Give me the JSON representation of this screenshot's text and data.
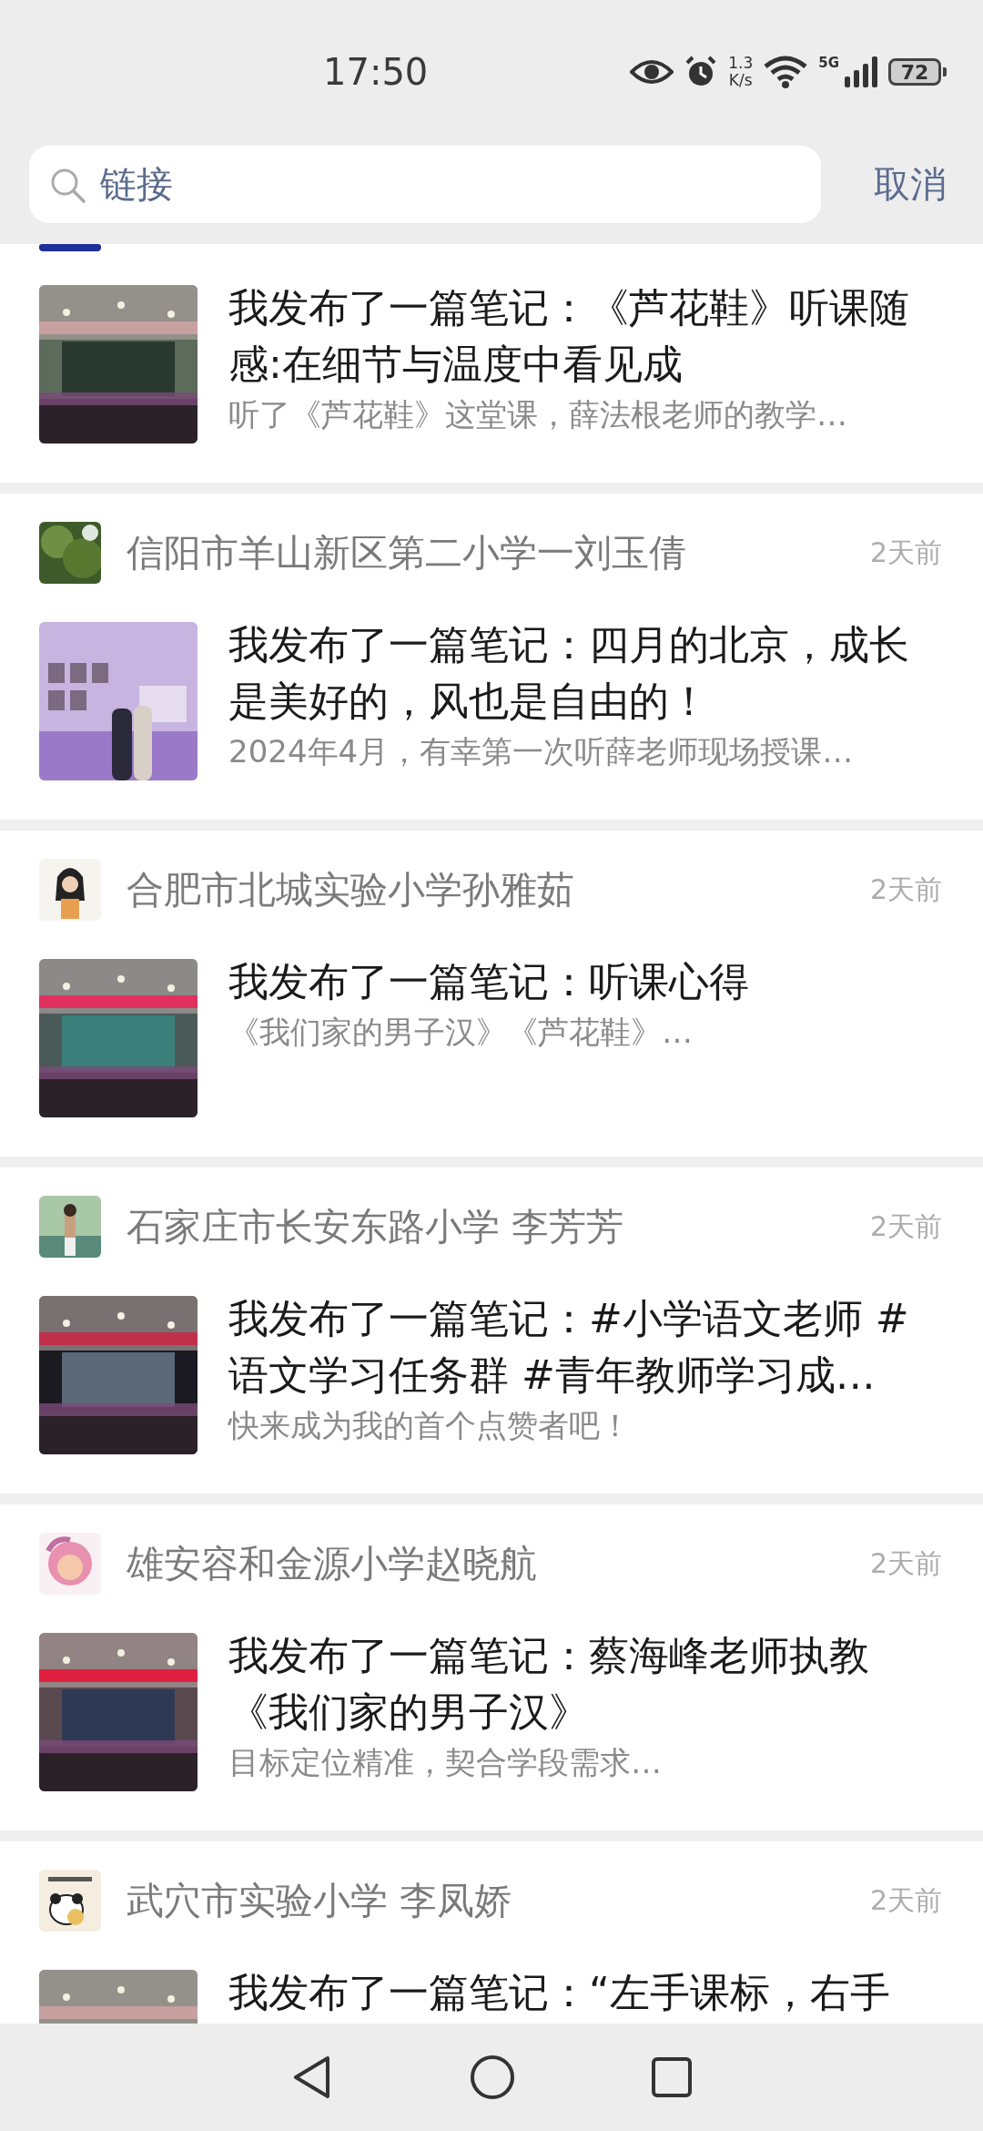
{
  "status_bar": {
    "time": "17:50",
    "speed_value": "1.3",
    "speed_unit": "K/s",
    "network": "5G",
    "battery": "72"
  },
  "search": {
    "value": "链接",
    "cancel": "取消"
  },
  "posts": [
    {
      "kind": "partial",
      "title": "我发布了一篇笔记：《芦花鞋》听课随感:在细节与温度中看见成",
      "snippet": "听了《芦花鞋》这堂课，薛法根老师的教学…"
    },
    {
      "kind": "full",
      "author": "信阳市羊山新区第二小学一刘玉倩",
      "time": "2天前",
      "title": "我发布了一篇笔记：四月的北京，成长是美好的，风也是自由的！",
      "snippet": "2024年4月，有幸第一次听薛老师现场授课…"
    },
    {
      "kind": "full",
      "author": "合肥市北城实验小学孙雅茹",
      "time": "2天前",
      "title": "我发布了一篇笔记：听课心得",
      "snippet": "《我们家的男子汉》《芦花鞋》…"
    },
    {
      "kind": "full",
      "author": "石家庄市长安东路小学 李芳芳",
      "time": "2天前",
      "title": "我发布了一篇笔记：#小学语文老师 #语文学习任务群 #青年教师学习成…",
      "snippet": "快来成为我的首个点赞者吧！"
    },
    {
      "kind": "full",
      "author": "雄安容和金源小学赵晓航",
      "time": "2天前",
      "title": "我发布了一篇笔记：蔡海峰老师执教《我们家的男子汉》",
      "snippet": "目标定位精准，契合学段需求…"
    },
    {
      "kind": "full",
      "author": "武穴市实验小学 李凤娇",
      "time": "2天前",
      "title": "我发布了一篇笔记：“左手课标，右手"
    }
  ]
}
